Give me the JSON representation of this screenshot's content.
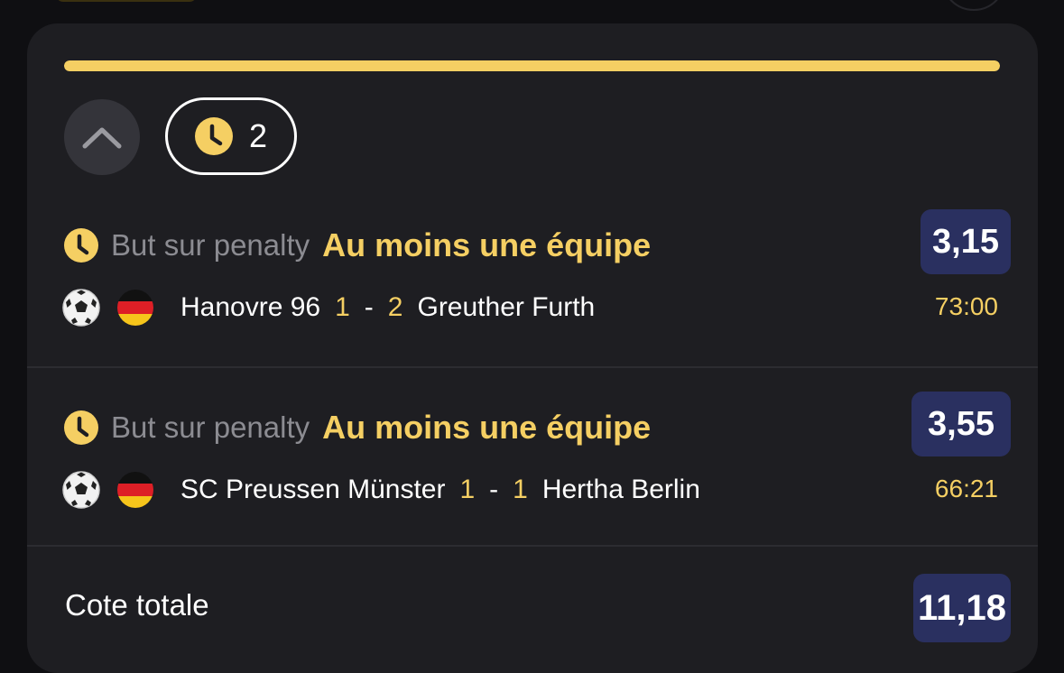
{
  "header": {
    "live_count": "2",
    "progress_fraction": 1.0
  },
  "bets": [
    {
      "market": "But sur penalty",
      "selection": "Au moins une équipe",
      "odds": "3,15",
      "home_team": "Hanovre 96",
      "home_score": "1",
      "away_score": "2",
      "away_team": "Greuther Furth",
      "time": "73:00"
    },
    {
      "market": "But sur penalty",
      "selection": "Au moins une équipe",
      "odds": "3,55",
      "home_team": "SC Preussen Münster",
      "home_score": "1",
      "away_score": "1",
      "away_team": "Hertha Berlin",
      "time": "66:21"
    }
  ],
  "separator": "-",
  "total": {
    "label": "Cote totale",
    "odds": "11,18"
  },
  "colors": {
    "accent": "#f5cf63",
    "odds_bg": "#2a3060",
    "card_bg": "#1e1e22"
  },
  "icons": {
    "collapse": "chevron-up-icon",
    "live": "clock-icon",
    "sport": "soccer-ball-icon",
    "country": "germany-flag-icon"
  }
}
